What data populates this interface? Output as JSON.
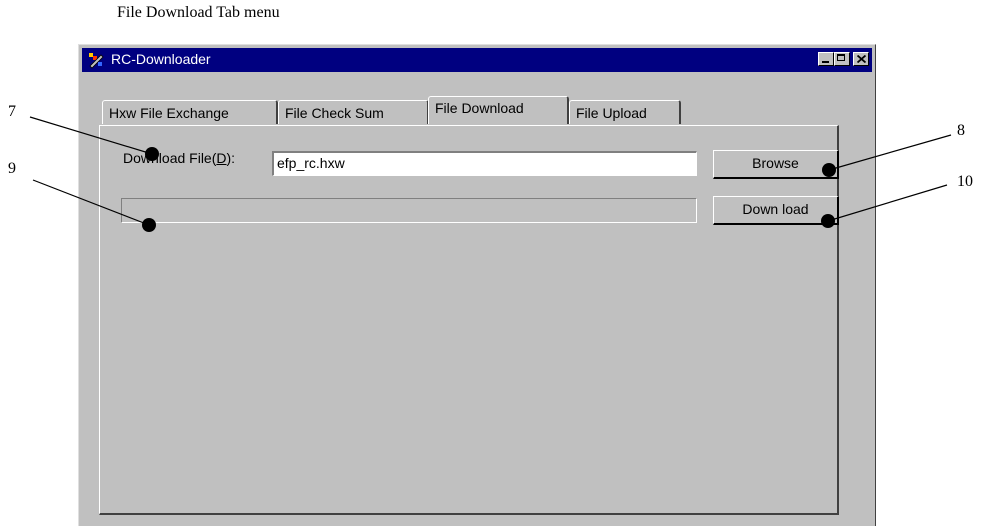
{
  "caption": "File Download Tab menu",
  "window": {
    "title": "RC-Downloader",
    "titlebar_color": "#000080",
    "face_color": "#c0c0c0"
  },
  "tabs": [
    {
      "label": "Hxw File Exchange",
      "active": false
    },
    {
      "label": "File Check Sum",
      "active": false
    },
    {
      "label": "File Download",
      "active": true
    },
    {
      "label": "File Upload",
      "active": false
    }
  ],
  "download_panel": {
    "file_label_prefix": "Download File(",
    "file_label_mnemonic": "D",
    "file_label_suffix": "):",
    "file_value": "efp_rc.hxw",
    "browse_label": "Browse",
    "download_label": "Down load",
    "progress_fraction": 0
  },
  "callouts": [
    {
      "number": "7",
      "target": "download-file-label"
    },
    {
      "number": "8",
      "target": "browse-button"
    },
    {
      "number": "9",
      "target": "progress-bar"
    },
    {
      "number": "10",
      "target": "download-button"
    }
  ]
}
